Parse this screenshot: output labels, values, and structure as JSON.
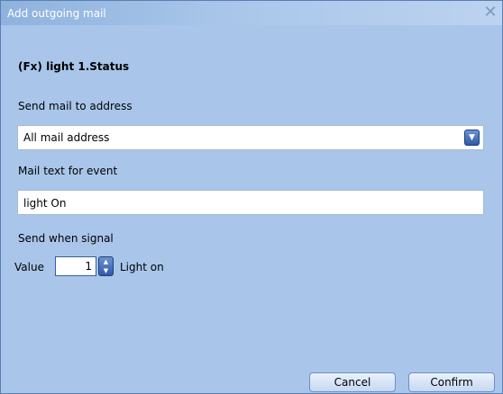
{
  "window": {
    "title": "Add outgoing mail"
  },
  "heading": "(Fx) light 1.Status",
  "send_to": {
    "label": "Send mail to address",
    "selected": "All mail address"
  },
  "mail_text": {
    "label": "Mail text for event",
    "value": "light On"
  },
  "signal": {
    "label": "Send when signal",
    "value_label": "Value",
    "value": "1",
    "value_text": "Light on"
  },
  "buttons": {
    "cancel": "Cancel",
    "confirm": "Confirm"
  },
  "colors": {
    "dialog_bg": "#a9c6ea",
    "accent": "#2f5aa8"
  }
}
